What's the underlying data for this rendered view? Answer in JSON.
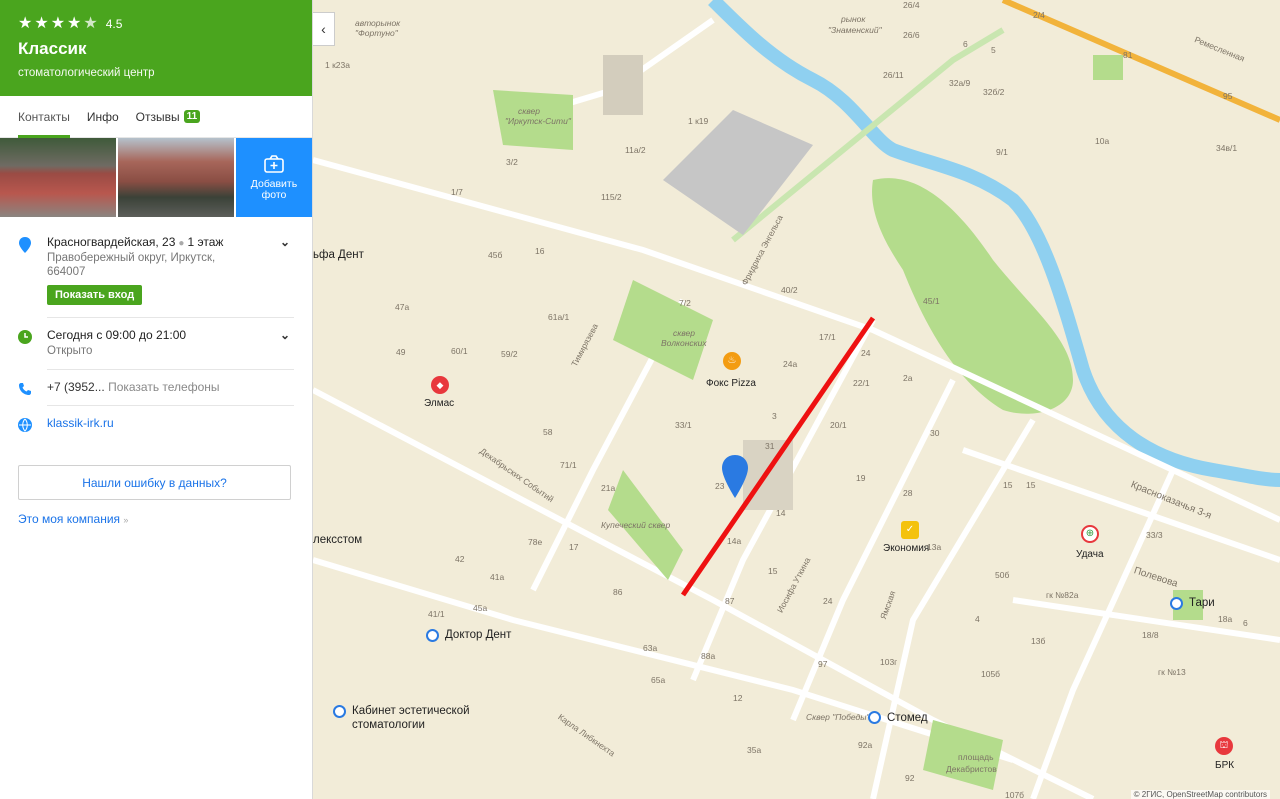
{
  "header": {
    "rating": "4.5",
    "title": "Классик",
    "subtitle": "стоматологический центр"
  },
  "tabs": [
    {
      "label": "Контакты"
    },
    {
      "label": "Инфо"
    },
    {
      "label": "Отзывы",
      "badge": "11"
    }
  ],
  "photos": {
    "add_label_1": "Добавить",
    "add_label_2": "фото"
  },
  "address": {
    "main": "Красногвардейская, 23",
    "floor": "1 этаж",
    "sub": "Правобережный округ, Иркутск, 664007",
    "entry_button": "Показать вход"
  },
  "hours": {
    "main": "Сегодня с 09:00 до 21:00",
    "status": "Открыто"
  },
  "phone": {
    "number": "+7 (3952...",
    "show": "Показать телефоны"
  },
  "website": "klassik-irk.ru",
  "error_button": "Нашли ошибку в данных?",
  "company_link": "Это моя компания",
  "map": {
    "labels": [
      {
        "text": "авторынок",
        "cls": "a1"
      },
      {
        "text": "\"Фортуно\"",
        "cls": "a2"
      },
      {
        "text": "рынок",
        "cls": "a3"
      },
      {
        "text": "\"Знаменский\"",
        "cls": "a4"
      },
      {
        "text": "сквер",
        "cls": "a5"
      },
      {
        "text": "\"Иркутск-Сити\"",
        "cls": "a6"
      },
      {
        "text": "сквер",
        "cls": "a7"
      },
      {
        "text": "Волконских",
        "cls": "a8"
      },
      {
        "text": "Купеческий сквер",
        "cls": "a9"
      },
      {
        "text": "Сквер \"Победы\"",
        "cls": "a10"
      },
      {
        "text": "площадь",
        "cls": "a11"
      },
      {
        "text": "Декабристов",
        "cls": "a12"
      },
      {
        "text": "Ремесленная",
        "cls": "a13"
      },
      {
        "text": "Красноказачья 3-я",
        "cls": "a14"
      },
      {
        "text": "Полевова",
        "cls": "a15"
      },
      {
        "text": "Фридриха Энгельса",
        "cls": "a16"
      },
      {
        "text": "Тимирязева",
        "cls": "a17"
      },
      {
        "text": "Декабрьских Событий",
        "cls": "a18"
      },
      {
        "text": "Иосифа Уткина",
        "cls": "a19"
      },
      {
        "text": "Ямская",
        "cls": "a20"
      },
      {
        "text": "Карла Либкнехта",
        "cls": "a21"
      },
      {
        "text": "гк №82а",
        "cls": "a22"
      },
      {
        "text": "гк №13",
        "cls": "a23"
      }
    ],
    "pois": [
      {
        "text": "ьфа Дент",
        "cls": "p1"
      },
      {
        "text": "Элмас",
        "cls": "p2"
      },
      {
        "text": "Фокс Pizza",
        "cls": "p3"
      },
      {
        "text": "Экономия",
        "cls": "p4"
      },
      {
        "text": "Удача",
        "cls": "p5"
      },
      {
        "text": "Тари",
        "cls": "p6"
      },
      {
        "text": "лексстом",
        "cls": "p7"
      },
      {
        "text": "Доктор Дент",
        "cls": "p8"
      },
      {
        "text": "Кабинет эстетической",
        "cls": "p9"
      },
      {
        "text": "стоматологии",
        "cls": "p10"
      },
      {
        "text": "Стомед",
        "cls": "p11"
      },
      {
        "text": "БРК",
        "cls": "p12"
      }
    ],
    "numbers": [
      "1 к23а",
      "115/2",
      "11а/2",
      "1 к19",
      "1/7",
      "3/2",
      "45б",
      "16",
      "47а",
      "61а/1",
      "59/2",
      "60/1",
      "49",
      "40/2",
      "17/1",
      "7/2",
      "24а",
      "24",
      "22/1",
      "45/1",
      "2а",
      "33/1",
      "58",
      "71/1",
      "3",
      "31",
      "20/1",
      "23",
      "14",
      "30",
      "19",
      "28",
      "13а",
      "15",
      "21а",
      "17",
      "78е",
      "14а",
      "42",
      "41а",
      "45а",
      "86",
      "87",
      "24",
      "15",
      "41/1",
      "63а",
      "88а",
      "65а",
      "97",
      "103г",
      "4",
      "13б",
      "15",
      "33/3",
      "18/8",
      "18а",
      "105б",
      "12",
      "35а",
      "92а",
      "92",
      "107б",
      "50б",
      "9/1",
      "10а",
      "34в/1",
      "26/4",
      "26/6",
      "26/11",
      "32а/9",
      "32б/2",
      "81",
      "95",
      "2/4",
      "6",
      "5",
      "6"
    ],
    "copyright": "© 2ГИС, OpenStreetMap contributors"
  }
}
